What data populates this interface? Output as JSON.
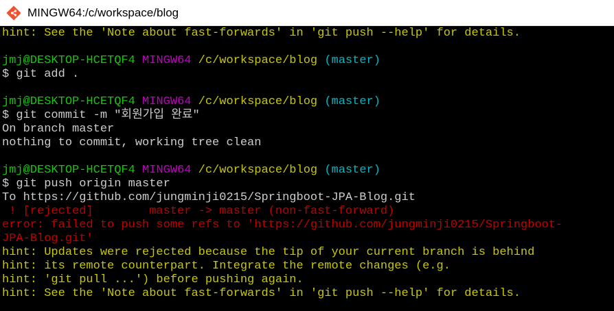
{
  "window": {
    "title": "MINGW64:/c/workspace/blog",
    "icon": "git-bash-icon"
  },
  "colors": {
    "hint": "#c8c800",
    "user": "#16c60c",
    "host": "#c000c0",
    "path": "#c8c800",
    "branch": "#00b7c3",
    "output": "#cccccc",
    "error": "#c00000"
  },
  "terminal": {
    "line1": "hint: See the 'Note about fast-forwards' in 'git push --help' for details.",
    "prompt1": {
      "user": "jmj@DESKTOP-HCETQF4",
      "host": "MINGW64",
      "path": "/c/workspace/blog",
      "branch": "(master)",
      "command": "$ git add ."
    },
    "prompt2": {
      "user": "jmj@DESKTOP-HCETQF4",
      "host": "MINGW64",
      "path": "/c/workspace/blog",
      "branch": "(master)",
      "command": "$ git commit -m \"회원가입 완료\""
    },
    "commit_output": [
      "On branch master",
      "nothing to commit, working tree clean"
    ],
    "prompt3": {
      "user": "jmj@DESKTOP-HCETQF4",
      "host": "MINGW64",
      "path": "/c/workspace/blog",
      "branch": "(master)",
      "command": "$ git push origin master"
    },
    "push_output": {
      "to": "To https://github.com/jungminji0215/Springboot-JPA-Blog.git",
      "rejected": " ! [rejected]        master -> master (non-fast-forward)",
      "error1": "error: failed to push some refs to 'https://github.com/jungminji0215/Springboot-",
      "error2": "JPA-Blog.git'",
      "hints": [
        "hint: Updates were rejected because the tip of your current branch is behind",
        "hint: its remote counterpart. Integrate the remote changes (e.g.",
        "hint: 'git pull ...') before pushing again.",
        "hint: See the 'Note about fast-forwards' in 'git push --help' for details."
      ]
    }
  }
}
